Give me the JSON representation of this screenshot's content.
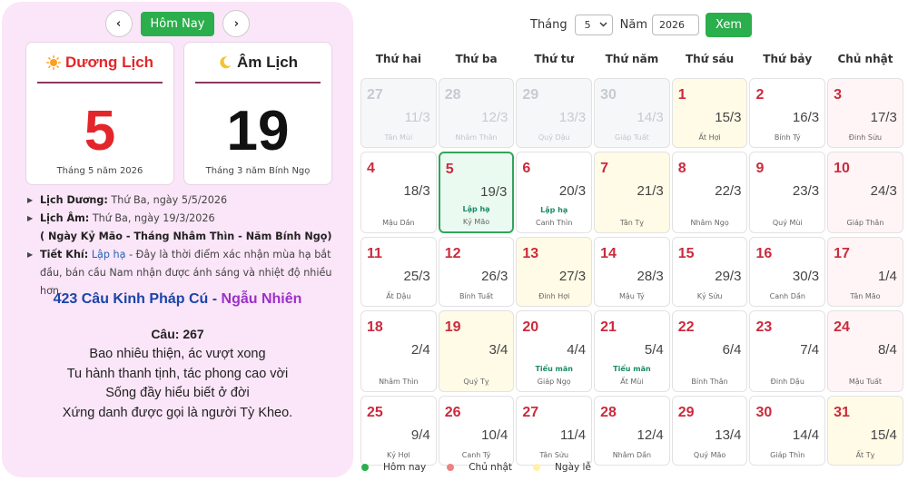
{
  "nav": {
    "prev_symbol": "‹",
    "today_label": "Hôm Nay",
    "next_symbol": "›"
  },
  "solar": {
    "icon": "sun-icon",
    "title": "Dương Lịch",
    "day": "5",
    "subtitle": "Tháng 5 năm 2026"
  },
  "lunar": {
    "icon": "moon-icon",
    "title": "Âm Lịch",
    "day": "19",
    "subtitle": "Tháng 3 năm Bính Ngọ"
  },
  "info": {
    "solar_label": "Lịch Dương:",
    "solar_value": "Thứ Ba, ngày 5/5/2026",
    "lunar_label": "Lịch Âm:",
    "lunar_value": "Thứ Ba, ngày 19/3/2026",
    "can_chi": "( Ngày Kỷ Mão - Tháng Nhâm Thìn - Năm Bính Ngọ)",
    "solar_term_label": "Tiết Khí:",
    "solar_term_name": "Lập hạ",
    "solar_term_desc": " - Đây là thời điểm xác nhận mùa hạ bắt đầu, bán cầu Nam nhận được ánh sáng và nhiệt độ nhiều hơn."
  },
  "verse": {
    "title": "423 Câu Kinh Pháp Cú",
    "separator": " - ",
    "random_label": "Ngẫu Nhiên",
    "number_label": "Câu: 267",
    "lines": [
      "Bao nhiêu thiện, ác vượt xong",
      "Tu hành thanh tịnh, tác phong cao vời",
      "Sống đầy hiểu biết ở đời",
      "Xứng danh được gọi là người Tỳ Kheo."
    ]
  },
  "controls": {
    "month_label": "Tháng",
    "month_value": "5",
    "year_label": "Năm",
    "year_value": "2026",
    "submit_label": "Xem"
  },
  "weekdays": [
    "Thứ hai",
    "Thứ ba",
    "Thứ tư",
    "Thứ năm",
    "Thứ sáu",
    "Thứ bảy",
    "Chủ nhật"
  ],
  "days": [
    {
      "d": "27",
      "l": "11/3",
      "c": "Tân Mùi",
      "type": "other"
    },
    {
      "d": "28",
      "l": "12/3",
      "c": "Nhâm Thân",
      "type": "other"
    },
    {
      "d": "29",
      "l": "13/3",
      "c": "Quý Dậu",
      "type": "other"
    },
    {
      "d": "30",
      "l": "14/3",
      "c": "Giáp Tuất",
      "type": "other"
    },
    {
      "d": "1",
      "l": "15/3",
      "c": "Ất Hợi",
      "type": "hol"
    },
    {
      "d": "2",
      "l": "16/3",
      "c": "Bính Tý",
      "type": ""
    },
    {
      "d": "3",
      "l": "17/3",
      "c": "Đinh Sửu",
      "type": "sun"
    },
    {
      "d": "4",
      "l": "18/3",
      "c": "Mậu Dần",
      "type": ""
    },
    {
      "d": "5",
      "l": "19/3",
      "c": "Kỷ Mão",
      "type": "today",
      "t": "Lập hạ"
    },
    {
      "d": "6",
      "l": "20/3",
      "c": "Canh Thìn",
      "type": "",
      "t": "Lập hạ"
    },
    {
      "d": "7",
      "l": "21/3",
      "c": "Tân Tỵ",
      "type": "hol"
    },
    {
      "d": "8",
      "l": "22/3",
      "c": "Nhâm Ngọ",
      "type": ""
    },
    {
      "d": "9",
      "l": "23/3",
      "c": "Quý Mùi",
      "type": ""
    },
    {
      "d": "10",
      "l": "24/3",
      "c": "Giáp Thân",
      "type": "sun"
    },
    {
      "d": "11",
      "l": "25/3",
      "c": "Ất Dậu",
      "type": ""
    },
    {
      "d": "12",
      "l": "26/3",
      "c": "Bính Tuất",
      "type": ""
    },
    {
      "d": "13",
      "l": "27/3",
      "c": "Đinh Hợi",
      "type": "hol"
    },
    {
      "d": "14",
      "l": "28/3",
      "c": "Mậu Tý",
      "type": ""
    },
    {
      "d": "15",
      "l": "29/3",
      "c": "Kỷ Sửu",
      "type": ""
    },
    {
      "d": "16",
      "l": "30/3",
      "c": "Canh Dần",
      "type": ""
    },
    {
      "d": "17",
      "l": "1/4",
      "c": "Tân Mão",
      "type": "sun"
    },
    {
      "d": "18",
      "l": "2/4",
      "c": "Nhâm Thìn",
      "type": ""
    },
    {
      "d": "19",
      "l": "3/4",
      "c": "Quý Tỵ",
      "type": "hol"
    },
    {
      "d": "20",
      "l": "4/4",
      "c": "Giáp Ngọ",
      "type": "",
      "t": "Tiểu mãn"
    },
    {
      "d": "21",
      "l": "5/4",
      "c": "Ất Mùi",
      "type": "",
      "t": "Tiểu mãn"
    },
    {
      "d": "22",
      "l": "6/4",
      "c": "Bính Thân",
      "type": ""
    },
    {
      "d": "23",
      "l": "7/4",
      "c": "Đinh Dậu",
      "type": ""
    },
    {
      "d": "24",
      "l": "8/4",
      "c": "Mậu Tuất",
      "type": "sun"
    },
    {
      "d": "25",
      "l": "9/4",
      "c": "Kỷ Hợi",
      "type": ""
    },
    {
      "d": "26",
      "l": "10/4",
      "c": "Canh Tý",
      "type": ""
    },
    {
      "d": "27",
      "l": "11/4",
      "c": "Tân Sửu",
      "type": ""
    },
    {
      "d": "28",
      "l": "12/4",
      "c": "Nhâm Dần",
      "type": ""
    },
    {
      "d": "29",
      "l": "13/4",
      "c": "Quý Mão",
      "type": ""
    },
    {
      "d": "30",
      "l": "14/4",
      "c": "Giáp Thìn",
      "type": ""
    },
    {
      "d": "31",
      "l": "15/4",
      "c": "Ất Tỵ",
      "type": "hol"
    }
  ],
  "legend": [
    {
      "label": "Hôm nay",
      "color": "#2bae4c"
    },
    {
      "label": "Chủ nhật",
      "color": "#f08080"
    },
    {
      "label": "Ngày lễ",
      "color": "#fff2a8"
    }
  ],
  "colors": {
    "accent_green": "#2bae4c",
    "solar_red": "#e3262b",
    "verse_blue": "#1a44a8",
    "verse_purple": "#9b30c9",
    "sunday_bg": "#fff5f6",
    "holiday_bg": "#fffbe6"
  }
}
